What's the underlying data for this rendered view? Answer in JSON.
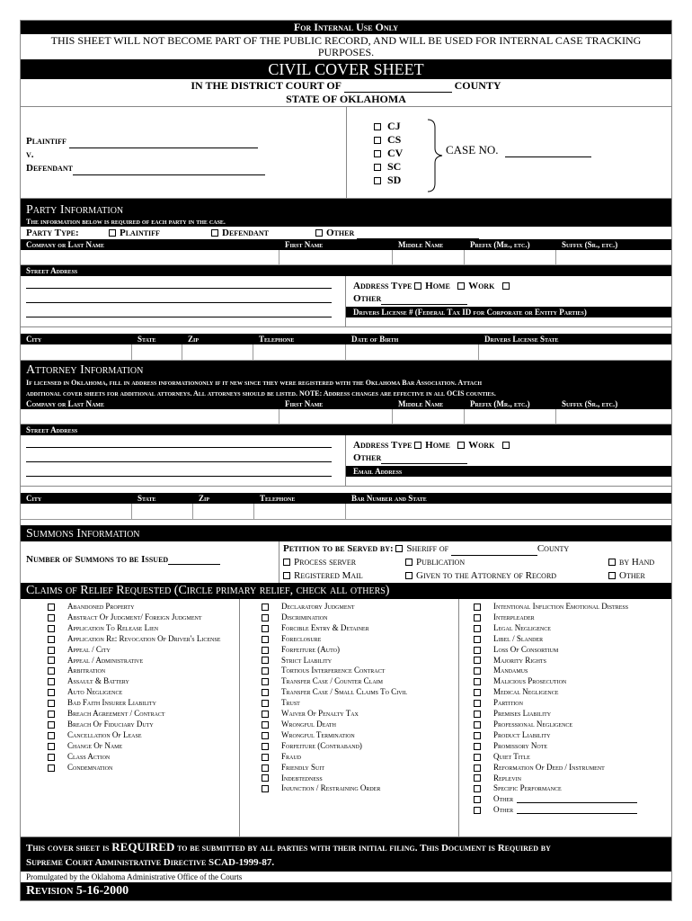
{
  "header": {
    "internal_use": "For Internal Use Only",
    "notice": "THIS SHEET WILL NOT BECOME PART OF THE PUBLIC RECORD, AND WILL BE USED FOR INTERNAL CASE TRACKING PURPOSES.",
    "title": "CIVIL COVER SHEET",
    "court_prefix": "IN THE DISTRICT COURT OF",
    "court_suffix": "COUNTY",
    "state": "STATE OF OKLAHOMA"
  },
  "caption": {
    "plaintiff_label": "Plaintiff",
    "versus": "v.",
    "defendant_label": "Defendant",
    "case_types": [
      "CJ",
      "CS",
      "CV",
      "SC",
      "SD"
    ],
    "case_no_label": "CASE NO."
  },
  "party": {
    "title": "Party Information",
    "subtitle": "The information below is required of each party in the case.",
    "party_type_label": "Party Type:",
    "party_types": [
      "Plaintiff",
      "Defendant",
      "Other"
    ],
    "name_headers": [
      "Company or Last Name",
      "First Name",
      "Middle Name",
      "Prefix (Mr., etc.)",
      "Suffix (Sr., etc.)"
    ],
    "street_address": "Street Address",
    "address_type_label": "Address Type",
    "address_types": [
      "Home",
      "Work"
    ],
    "other_label": "Other",
    "drivers_license": "Drivers License # (Federal Tax ID for Corporate or Entity Parties)",
    "city_headers": [
      "City",
      "State",
      "Zip",
      "Telephone",
      "Date of Birth",
      "Drivers License State"
    ]
  },
  "attorney": {
    "title": "Attorney Information",
    "note_line1": "If licensed in Oklahoma, fill in address informationonly if it new since they were registered with the Oklahoma Bar Association. Attach",
    "note_line2": "additional cover sheets for additional attorneys.  All attorneys should be listed. NOTE: Address changes are effective in all OCIS counties.",
    "name_headers": [
      "Company or Last Name",
      "First Name",
      "Middle Name",
      "Prefix (Mr., etc.)",
      "Suffix (Sr., etc.)"
    ],
    "street_address": "Street Address",
    "address_type_label": "Address Type",
    "address_types": [
      "Home",
      "Work"
    ],
    "other_label": "Other",
    "email": "Email Address",
    "city_headers": [
      "City",
      "State",
      "Zip",
      "Telephone",
      "Bar Number and State"
    ]
  },
  "summons": {
    "title": "Summons Information",
    "number_label": "Number of Summons to be Issued",
    "served_by_label": "Petition to be Served by:",
    "sheriff_of": "Sheriff of",
    "county": "County",
    "options": [
      "Process server",
      "Publication",
      "by Hand",
      "Registered Mail",
      "Given to the Attorney of Record",
      "Other"
    ]
  },
  "claims": {
    "title": "Claims of Relief Requested (Circle primary relief, check all others)",
    "columns": [
      [
        "Abandoned Property",
        "Abstract Of Judgment/ Foreign Judgment",
        "Application To Release Lien",
        "Application Re: Revocation Of Driver's License",
        "Appeal / City",
        "Appeal / Administrative",
        "Arbitration",
        "Assault & Battery",
        "Auto Negligence",
        "Bad Faith Insurer Liability",
        "Breach Agreement / Contract",
        "Breach Of Fiduciary Duty",
        "Cancellation Of Lease",
        "Change Of Name",
        "Class Action",
        "Condemnation"
      ],
      [
        "Declaratory Judgment",
        "Discrimination",
        "Forcible Entry & Detainer",
        "Foreclosure",
        "Forfeiture (Auto)",
        "Strict Liability",
        "Tortious Interference Contract",
        "Transfer Case / Counter Claim",
        "Transfer Case / Small Claims To Civil",
        "Trust",
        "Waiver Of Penalty Tax",
        "Wrongful Death",
        "Wrongful Termination",
        "Forfeiture (Contraband)",
        "Fraud",
        "Friendly Suit",
        "Indebtedness",
        "Injunction / Restraining Order"
      ],
      [
        "Intentional Infliction Emotional Distress",
        "Interpleader",
        "Legal Negligence",
        "Libel / Slander",
        "Loss Of Consortium",
        "Majority Rights",
        "Mandamus",
        "Malicious Prosecution",
        "Medical Negligence",
        "Partition",
        "Premises Liability",
        "Professional Negligence",
        "Product Liability",
        "Promissory Note",
        "Quiet Title",
        "Reformation Of Deed / Instrument",
        "Replevin",
        "Specific Performance",
        "Other",
        "Other"
      ]
    ]
  },
  "footer": {
    "required_pre": "This cover sheet is",
    "required_word": "REQUIRED",
    "required_post": "to be submitted by all parties with their initial filing.  This Document is Required by",
    "directive": "Supreme Court Administrative Directive SCAD-1999-87.",
    "promulgated": "Promulgated by the Oklahoma Administrative Office of the Courts",
    "revision": "Revision 5-16-2000"
  }
}
